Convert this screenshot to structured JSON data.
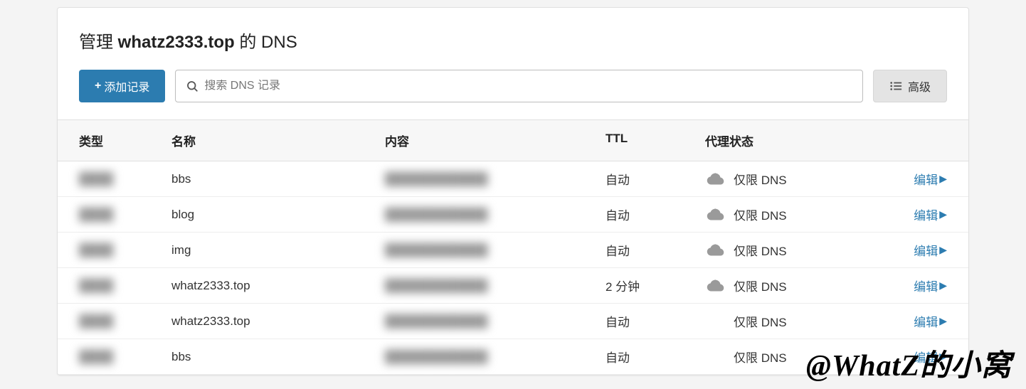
{
  "title": {
    "prefix": "管理 ",
    "domain": "whatz2333.top",
    "suffix": " 的 DNS"
  },
  "toolbar": {
    "add_label": "添加记录",
    "search_placeholder": "搜索 DNS 记录",
    "advanced_label": "高级"
  },
  "columns": {
    "type": "类型",
    "name": "名称",
    "content": "内容",
    "ttl": "TTL",
    "proxy": "代理状态"
  },
  "proxy_label": "仅限 DNS",
  "edit_label": "编辑",
  "records": [
    {
      "type": "",
      "name": "bbs",
      "content": "",
      "ttl": "自动",
      "cloud": true
    },
    {
      "type": "",
      "name": "blog",
      "content": "",
      "ttl": "自动",
      "cloud": true
    },
    {
      "type": "",
      "name": "img",
      "content": "",
      "ttl": "自动",
      "cloud": true
    },
    {
      "type": "",
      "name": "whatz2333.top",
      "content": "",
      "ttl": "2 分钟",
      "cloud": true
    },
    {
      "type": "",
      "name": "whatz2333.top",
      "content": "",
      "ttl": "自动",
      "cloud": false
    },
    {
      "type": "",
      "name": "bbs",
      "content": "",
      "ttl": "自动",
      "cloud": false
    }
  ],
  "watermark": "@WhatZ的小窝"
}
